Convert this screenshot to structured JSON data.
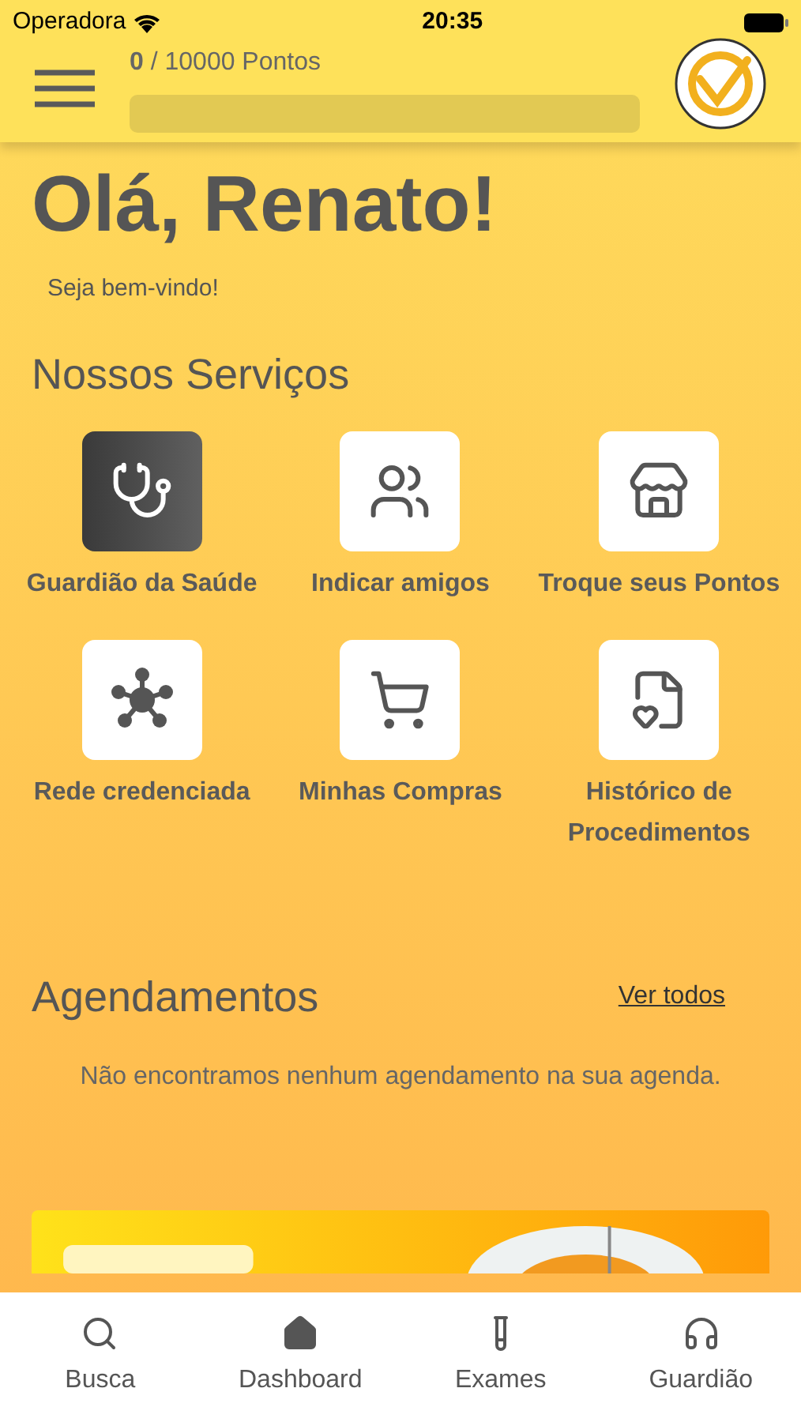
{
  "status_bar": {
    "carrier": "Operadora",
    "time": "20:35"
  },
  "points": {
    "current": "0",
    "total": " / 10000 Pontos",
    "level": 0
  },
  "greeting": {
    "title": "Olá, Renato!",
    "subtitle": "Seja bem-vindo!"
  },
  "services": {
    "title": "Nossos Serviços",
    "items": [
      {
        "kind": "stethoscope",
        "label": "Guardião da Saúde",
        "selected": true
      },
      {
        "kind": "friends",
        "label": "Indicar amigos",
        "selected": false
      },
      {
        "kind": "store",
        "label": "Troque seus Pontos",
        "selected": false
      },
      {
        "kind": "network",
        "label": "Rede credenciada",
        "selected": false
      },
      {
        "kind": "cart",
        "label": "Minhas Compras",
        "selected": false
      },
      {
        "kind": "report",
        "label": "Histórico de Procedimentos",
        "selected": false
      }
    ]
  },
  "appointments": {
    "title": "Agendamentos",
    "link": "Ver todos",
    "empty": "Não encontramos nenhum agendamento na sua agenda."
  },
  "tab_bar": [
    {
      "kind": "search",
      "label": "Busca"
    },
    {
      "kind": "home",
      "label": "Dashboard"
    },
    {
      "kind": "tube",
      "label": "Exames"
    },
    {
      "kind": "headset",
      "label": "Guardião"
    }
  ]
}
